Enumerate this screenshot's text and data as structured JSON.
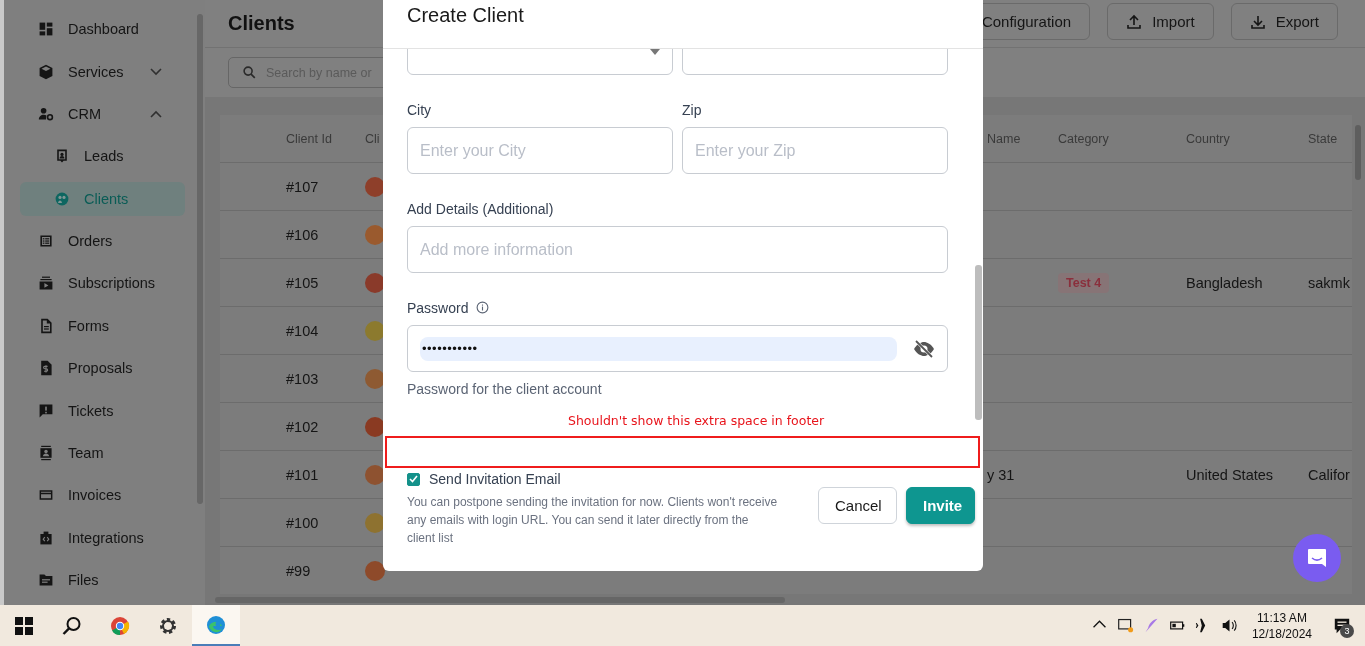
{
  "sidebar": {
    "items": [
      {
        "kind": "link",
        "label": "Dashboard",
        "selected": false
      },
      {
        "kind": "group",
        "label": "Services",
        "selected": false,
        "expanded": false
      },
      {
        "kind": "group",
        "label": "CRM",
        "selected": false,
        "expanded": true,
        "children": [
          {
            "label": "Leads",
            "selected": false
          },
          {
            "label": "Clients",
            "selected": true
          }
        ]
      },
      {
        "kind": "link",
        "label": "Orders",
        "selected": false
      },
      {
        "kind": "link",
        "label": "Subscriptions",
        "selected": false
      },
      {
        "kind": "link",
        "label": "Forms",
        "selected": false
      },
      {
        "kind": "link",
        "label": "Proposals",
        "selected": false
      },
      {
        "kind": "link",
        "label": "Tickets",
        "selected": false
      },
      {
        "kind": "link",
        "label": "Team",
        "selected": false
      },
      {
        "kind": "link",
        "label": "Invoices",
        "selected": false
      },
      {
        "kind": "link",
        "label": "Integrations",
        "selected": false
      },
      {
        "kind": "link",
        "label": "Files",
        "selected": false
      }
    ]
  },
  "page": {
    "title": "Clients",
    "actions": [
      "Configuration",
      "Import",
      "Export"
    ],
    "search": {
      "placeholder": "Search by name or"
    }
  },
  "table": {
    "columns": [
      "Client Id",
      "Cli",
      "Name",
      "Category",
      "Country",
      "State"
    ],
    "rows": [
      {
        "id": "#107"
      },
      {
        "id": "#106"
      },
      {
        "id": "#105",
        "category": "Test 4",
        "country": "Bangladesh",
        "state": "sakmk"
      },
      {
        "id": "#104"
      },
      {
        "id": "#103"
      },
      {
        "id": "#102"
      },
      {
        "id": "#101",
        "name": "y 31",
        "country": "United States",
        "state": "Califor"
      },
      {
        "id": "#100"
      },
      {
        "id": "#99"
      }
    ]
  },
  "modal": {
    "title": "Create Client",
    "fields": [
      {
        "kind": "select"
      },
      {
        "kind": "text"
      },
      {
        "kind": "text",
        "label": "City",
        "placeholder": "Enter your City"
      },
      {
        "kind": "text",
        "label": "Zip",
        "placeholder": "Enter your Zip"
      },
      {
        "kind": "long_text",
        "label": "Add Details",
        "hint": "(Additional)",
        "placeholder": "Add more information"
      },
      {
        "kind": "password",
        "label": "Password",
        "value": "•••••••••••",
        "help": "Password for the client account"
      }
    ],
    "footer": {
      "invite": {
        "label": "Send Invitation Email",
        "checked": true
      },
      "note": "You can postpone sending the invitation for now. Clients won't receive any emails with login URL. You can send it later directly from the client list",
      "buttons": [
        {
          "label": "Cancel",
          "kind": "secondary"
        },
        {
          "label": "Invite",
          "kind": "primary"
        }
      ]
    }
  },
  "annotation": {
    "text": "Shouldn't show this extra space in footer"
  },
  "taskbar": {
    "time": "11:13 AM",
    "date": "12/18/2024",
    "notifications": "3"
  }
}
